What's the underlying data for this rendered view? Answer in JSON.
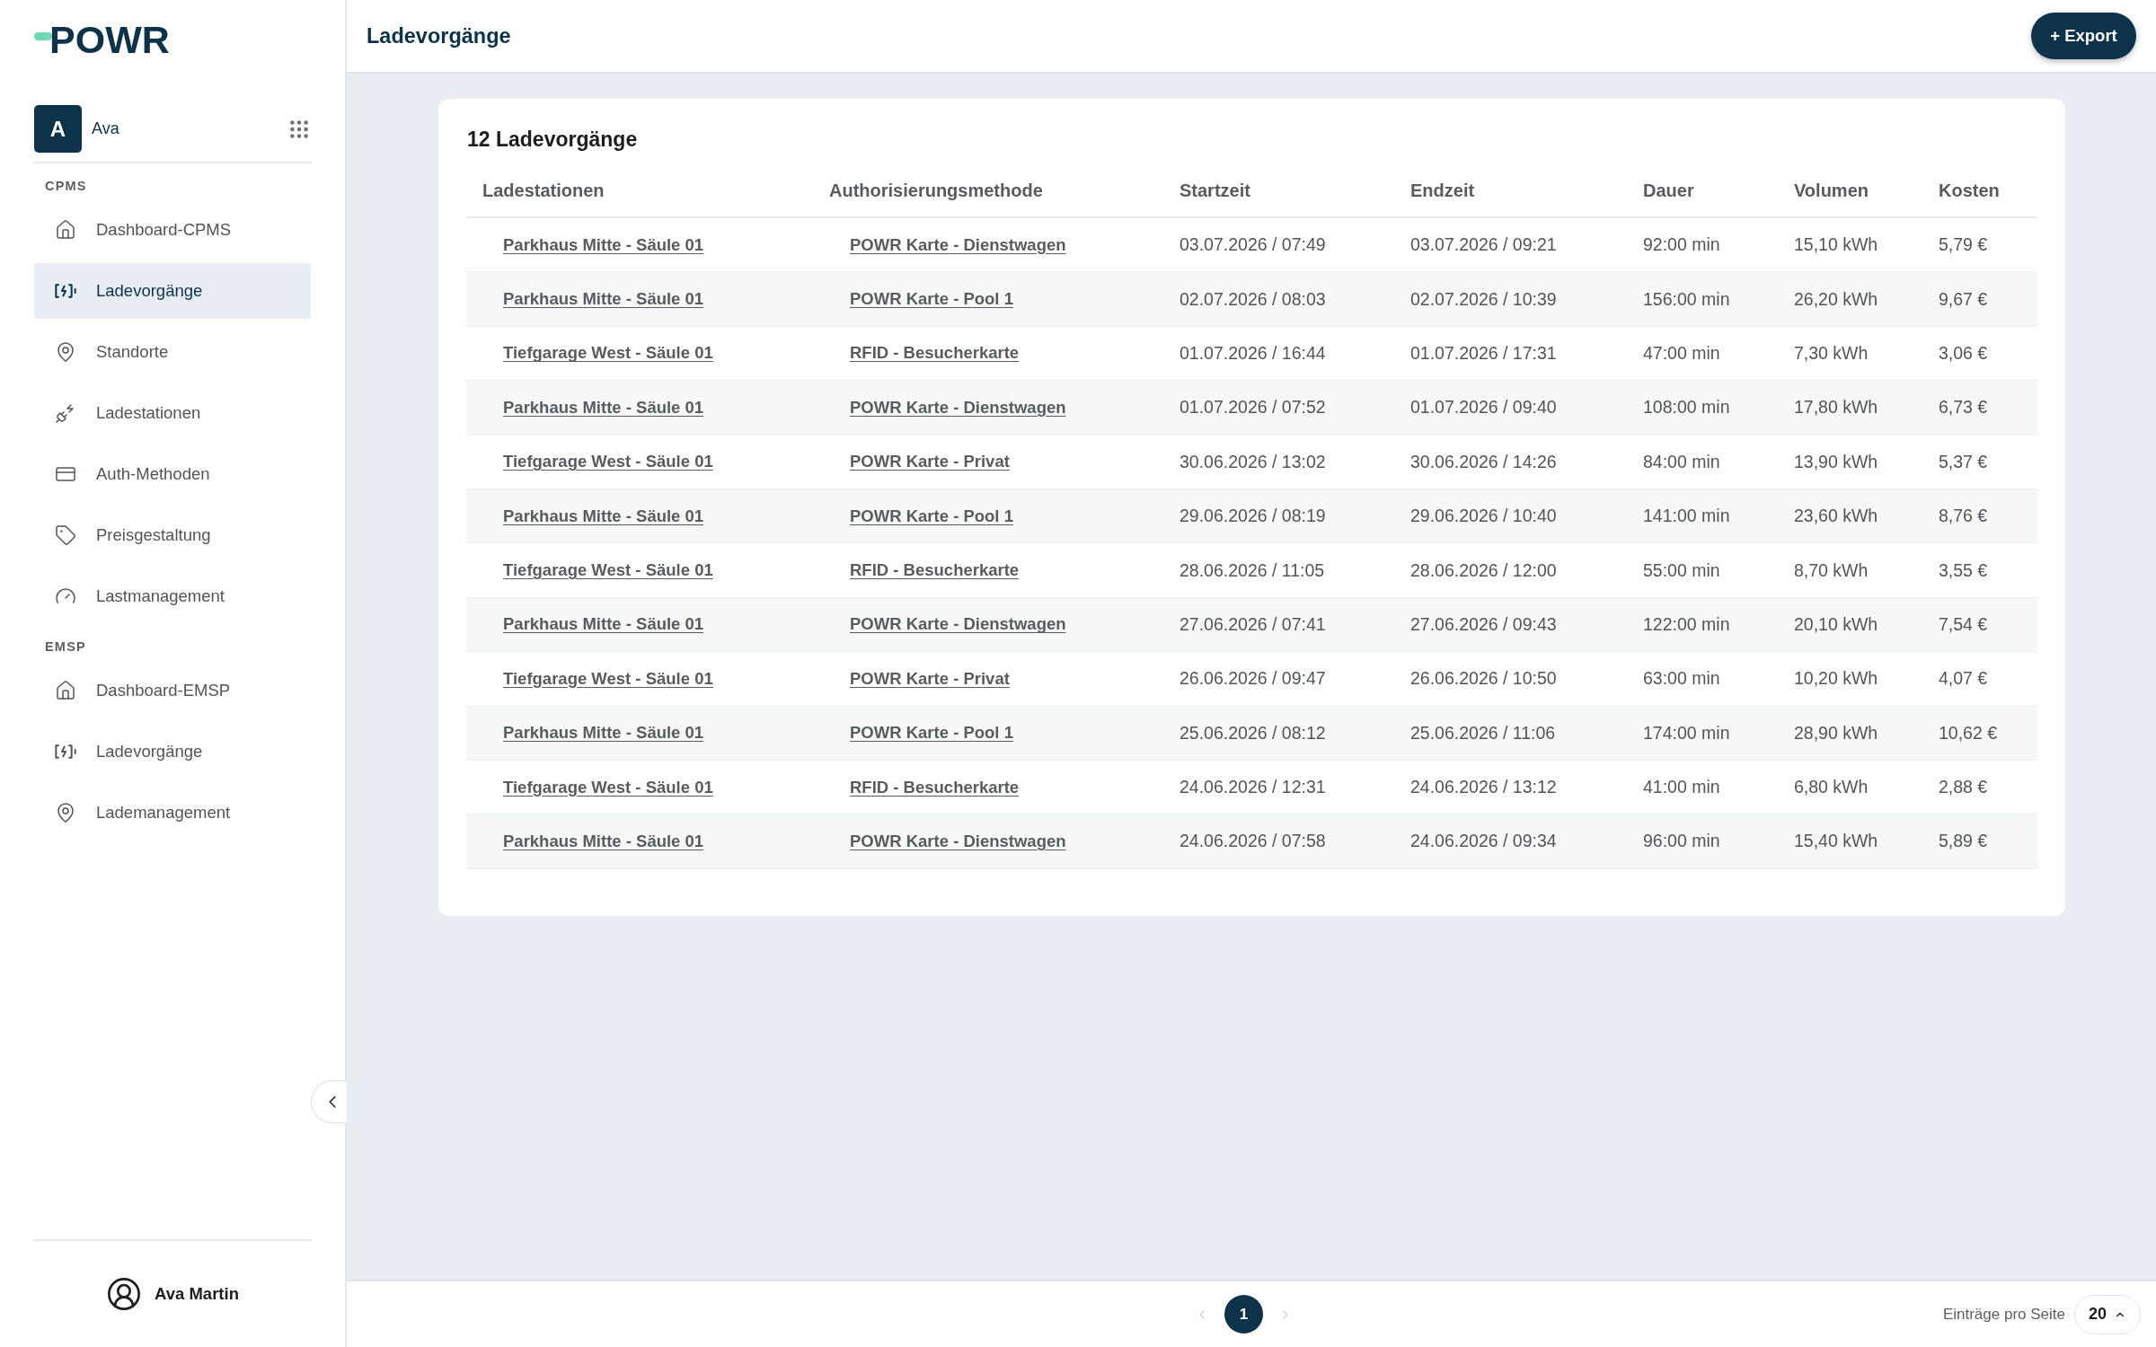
{
  "sidebar": {
    "logo": "POWR",
    "workspace": {
      "initial": "A",
      "name": "Ava"
    },
    "sections": [
      {
        "title": "CPMS",
        "items": [
          {
            "label": "Dashboard-CPMS",
            "kind": "home",
            "selected": false
          },
          {
            "label": "Ladevorgänge",
            "kind": "charging",
            "selected": true
          },
          {
            "label": "Standorte",
            "kind": "location",
            "selected": false
          },
          {
            "label": "Ladestationen",
            "kind": "plug",
            "selected": false
          },
          {
            "label": "Auth-Methoden",
            "kind": "card",
            "selected": false
          },
          {
            "label": "Preisgestaltung",
            "kind": "tag",
            "selected": false
          },
          {
            "label": "Lastmanagement",
            "kind": "gauge",
            "selected": false
          }
        ]
      },
      {
        "title": "EMSP",
        "items": [
          {
            "label": "Dashboard-EMSP",
            "kind": "home",
            "selected": false
          },
          {
            "label": "Ladevorgänge",
            "kind": "charging",
            "selected": false
          },
          {
            "label": "Lademanagement",
            "kind": "location",
            "selected": false
          }
        ]
      }
    ],
    "user": {
      "name": "Ava Martin"
    }
  },
  "header": {
    "title": "Ladevorgänge",
    "export_button": "+ Export"
  },
  "card": {
    "title": "12 Ladevorgänge"
  },
  "table": {
    "columns": [
      {
        "label": "Ladestationen",
        "kind": "link"
      },
      {
        "label": "Authorisierungsmethode",
        "kind": "link"
      },
      {
        "label": "Startzeit",
        "kind": "text"
      },
      {
        "label": "Endzeit",
        "kind": "text"
      },
      {
        "label": "Dauer",
        "kind": "text"
      },
      {
        "label": "Volumen",
        "kind": "text"
      },
      {
        "label": "Kosten",
        "kind": "text"
      }
    ],
    "rows": [
      [
        "Parkhaus Mitte - Säule 01",
        "POWR Karte - Dienstwagen",
        "03.07.2026 / 07:49",
        "03.07.2026 / 09:21",
        "92:00 min",
        "15,10 kWh",
        "5,79 €"
      ],
      [
        "Parkhaus Mitte - Säule 01",
        "POWR Karte - Pool 1",
        "02.07.2026 / 08:03",
        "02.07.2026 / 10:39",
        "156:00 min",
        "26,20 kWh",
        "9,67 €"
      ],
      [
        "Tiefgarage West - Säule 01",
        "RFID - Besucherkarte",
        "01.07.2026 / 16:44",
        "01.07.2026 / 17:31",
        "47:00 min",
        "7,30 kWh",
        "3,06 €"
      ],
      [
        "Parkhaus Mitte - Säule 01",
        "POWR Karte - Dienstwagen",
        "01.07.2026 / 07:52",
        "01.07.2026 / 09:40",
        "108:00 min",
        "17,80 kWh",
        "6,73 €"
      ],
      [
        "Tiefgarage West - Säule 01",
        "POWR Karte - Privat",
        "30.06.2026 / 13:02",
        "30.06.2026 / 14:26",
        "84:00 min",
        "13,90 kWh",
        "5,37 €"
      ],
      [
        "Parkhaus Mitte - Säule 01",
        "POWR Karte - Pool 1",
        "29.06.2026 / 08:19",
        "29.06.2026 / 10:40",
        "141:00 min",
        "23,60 kWh",
        "8,76 €"
      ],
      [
        "Tiefgarage West - Säule 01",
        "RFID - Besucherkarte",
        "28.06.2026 / 11:05",
        "28.06.2026 / 12:00",
        "55:00 min",
        "8,70 kWh",
        "3,55 €"
      ],
      [
        "Parkhaus Mitte - Säule 01",
        "POWR Karte - Dienstwagen",
        "27.06.2026 / 07:41",
        "27.06.2026 / 09:43",
        "122:00 min",
        "20,10 kWh",
        "7,54 €"
      ],
      [
        "Tiefgarage West - Säule 01",
        "POWR Karte - Privat",
        "26.06.2026 / 09:47",
        "26.06.2026 / 10:50",
        "63:00 min",
        "10,20 kWh",
        "4,07 €"
      ],
      [
        "Parkhaus Mitte - Säule 01",
        "POWR Karte - Pool 1",
        "25.06.2026 / 08:12",
        "25.06.2026 / 11:06",
        "174:00 min",
        "28,90 kWh",
        "10,62 €"
      ],
      [
        "Tiefgarage West - Säule 01",
        "RFID - Besucherkarte",
        "24.06.2026 / 12:31",
        "24.06.2026 / 13:12",
        "41:00 min",
        "6,80 kWh",
        "2,88 €"
      ],
      [
        "Parkhaus Mitte - Säule 01",
        "POWR Karte - Dienstwagen",
        "24.06.2026 / 07:58",
        "24.06.2026 / 09:34",
        "96:00 min",
        "15,40 kWh",
        "5,89 €"
      ]
    ]
  },
  "pagination": {
    "previous": {
      "disabled": true
    },
    "pages": [
      {
        "label": "1",
        "selected": true
      }
    ],
    "next": {
      "disabled": true
    },
    "page_size_label": "Einträge pro Seite",
    "page_size": "20"
  }
}
